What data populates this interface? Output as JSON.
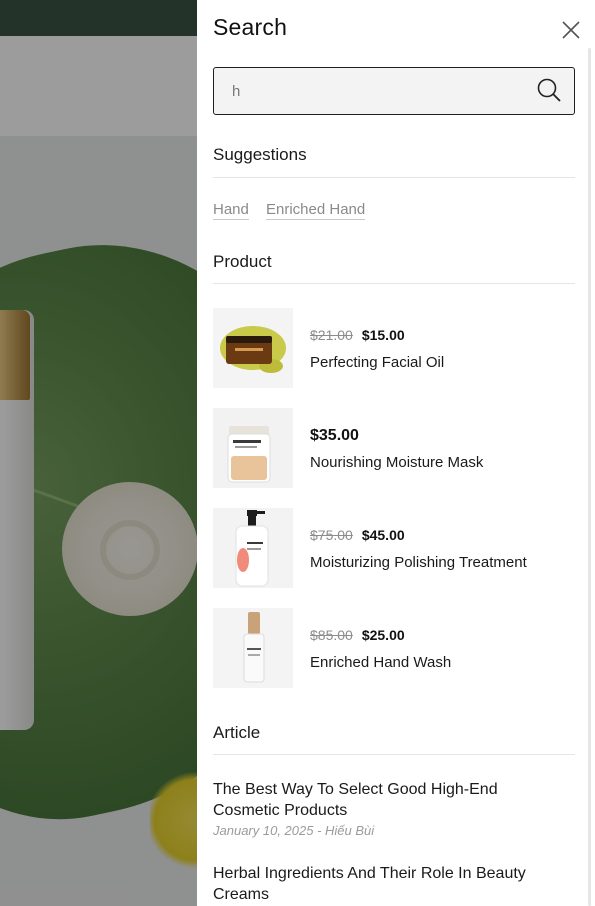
{
  "drawer": {
    "title": "Search",
    "close_icon": "close-icon"
  },
  "search": {
    "value": "h",
    "search_icon": "search-icon"
  },
  "suggestions": {
    "heading": "Suggestions",
    "items": [
      {
        "label": "Hand"
      },
      {
        "label": "Enriched Hand"
      }
    ]
  },
  "products": {
    "heading": "Product",
    "items": [
      {
        "old_price": "$21.00",
        "price": "$15.00",
        "name": "Perfecting Facial Oil"
      },
      {
        "old_price": "",
        "price": "$35.00",
        "name": "Nourishing Moisture Mask"
      },
      {
        "old_price": "$75.00",
        "price": "$45.00",
        "name": "Moisturizing Polishing Treatment"
      },
      {
        "old_price": "$85.00",
        "price": "$25.00",
        "name": "Enriched Hand Wash"
      }
    ]
  },
  "articles": {
    "heading": "Article",
    "items": [
      {
        "title": "The Best Way To Select Good High-End Cosmetic Products",
        "meta": "January 10, 2025 - Hiếu Bùi"
      },
      {
        "title": "Herbal Ingredients And Their Role In Beauty Creams",
        "meta": ""
      }
    ]
  },
  "colors": {
    "top_bar": "#2f4a3a",
    "overlay": "rgba(20,20,20,0.42)",
    "drawer_bg": "#ffffff",
    "search_bg": "#f3f3f3"
  }
}
